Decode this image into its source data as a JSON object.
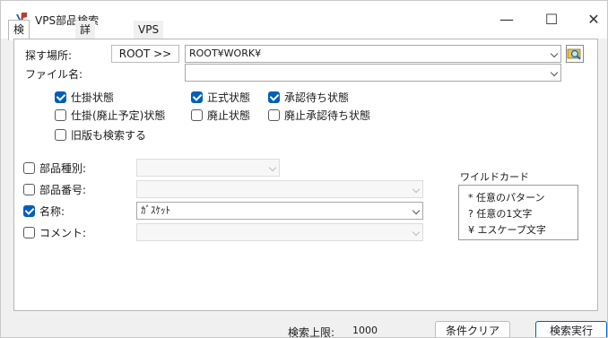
{
  "window": {
    "title": "VPS部品検索",
    "minimize": "—",
    "maximize": "☐",
    "close": "✕"
  },
  "tabs": [
    "検索条件",
    "詳細条件",
    "VPS表形式情報"
  ],
  "search_location": {
    "label": "探す場所:",
    "root_button": "ROOT >>",
    "value": "ROOT¥WORK¥"
  },
  "file_name": {
    "label": "ファイル名:",
    "value": ""
  },
  "statuses": [
    {
      "label": "仕掛状態",
      "checked": true
    },
    {
      "label": "正式状態",
      "checked": true
    },
    {
      "label": "承認待ち状態",
      "checked": true
    },
    {
      "label": "仕掛(廃止予定)状態",
      "checked": false
    },
    {
      "label": "廃止状態",
      "checked": false
    },
    {
      "label": "廃止承認待ち状態",
      "checked": false
    },
    {
      "label": "旧版も検索する",
      "checked": false
    }
  ],
  "filters": [
    {
      "label": "部品種別:",
      "checked": false,
      "value": ""
    },
    {
      "label": "部品番号:",
      "checked": false,
      "value": ""
    },
    {
      "label": "名称:",
      "checked": true,
      "value": "ｶﾞｽｹｯﾄ"
    },
    {
      "label": "コメント:",
      "checked": false,
      "value": ""
    }
  ],
  "wildcard": {
    "title": "ワイルドカード",
    "lines": [
      "* 任意のパターン",
      "? 任意の1文字",
      "¥ エスケープ文字"
    ]
  },
  "footer": {
    "limit_label": "検索上限:",
    "limit_value": "1000",
    "clear_button": "条件クリア",
    "search_button": "検索実行"
  },
  "colors": {
    "accent": "#005fb8",
    "icon_red": "#c0392b"
  },
  "icons": {
    "app": "vps-logo-icon",
    "search": "folder-search-icon"
  }
}
